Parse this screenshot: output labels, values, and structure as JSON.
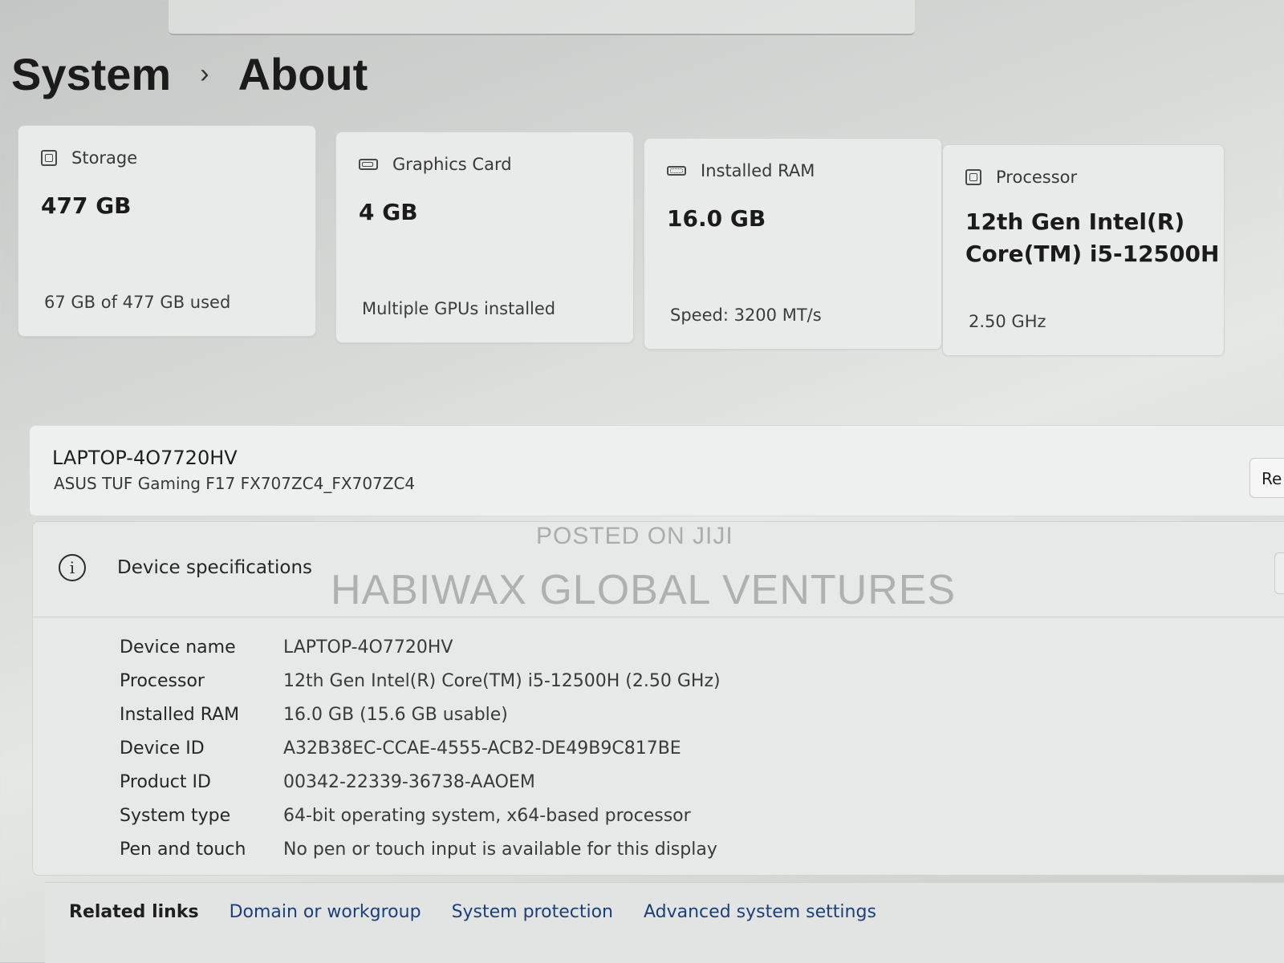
{
  "breadcrumb": {
    "parent": "System",
    "separator": "›",
    "current": "About"
  },
  "cards": [
    {
      "id": "storage",
      "icon": "storage-icon",
      "label": "Storage",
      "value": "477 GB",
      "detail": "67 GB of 477 GB used"
    },
    {
      "id": "graphics",
      "icon": "graphics-card-icon",
      "label": "Graphics Card",
      "value": "4 GB",
      "detail": "Multiple GPUs installed"
    },
    {
      "id": "ram",
      "icon": "ram-icon",
      "label": "Installed RAM",
      "value": "16.0 GB",
      "detail": "Speed: 3200 MT/s"
    },
    {
      "id": "processor",
      "icon": "processor-icon",
      "label": "Processor",
      "value_line1": "12th Gen Intel(R)",
      "value_line2": "Core(TM) i5-12500H",
      "detail": "2.50 GHz"
    }
  ],
  "device": {
    "name": "LAPTOP-4O7720HV",
    "model": "ASUS TUF Gaming F17 FX707ZC4_FX707ZC4",
    "rename_label": "Re"
  },
  "specs": {
    "title": "Device specifications",
    "rows": [
      {
        "key": "Device name",
        "value": "LAPTOP-4O7720HV"
      },
      {
        "key": "Processor",
        "value": "12th Gen Intel(R) Core(TM) i5-12500H (2.50 GHz)"
      },
      {
        "key": "Installed RAM",
        "value": "16.0 GB (15.6 GB usable)"
      },
      {
        "key": "Device ID",
        "value": "A32B38EC-CCAE-4555-ACB2-DE49B9C817BE"
      },
      {
        "key": "Product ID",
        "value": "00342-22339-36738-AAOEM"
      },
      {
        "key": "System type",
        "value": "64-bit operating system, x64-based processor"
      },
      {
        "key": "Pen and touch",
        "value": "No pen or touch input is available for this display"
      }
    ]
  },
  "related": {
    "label": "Related links",
    "links": [
      "Domain or workgroup",
      "System protection",
      "Advanced system settings"
    ]
  },
  "watermark": {
    "line1": "POSTED ON JIJI",
    "line2": "HABIWAX GLOBAL VENTURES"
  }
}
